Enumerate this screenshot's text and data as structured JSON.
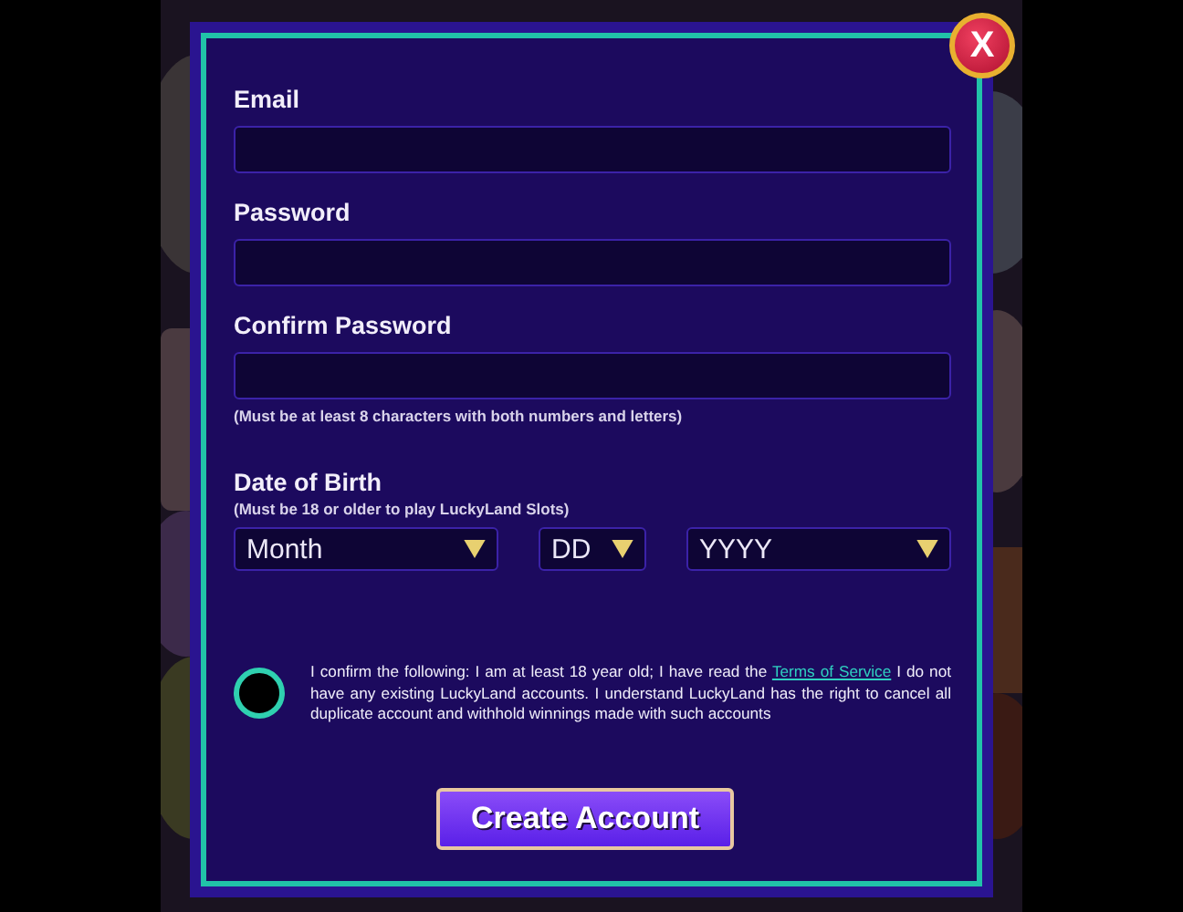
{
  "close_button": {
    "label": "X"
  },
  "fields": [
    {
      "kind": "input",
      "label": "Email"
    },
    {
      "kind": "input",
      "label": "Password"
    },
    {
      "kind": "input",
      "label": "Confirm Password",
      "hint": "(Must be at least 8 characters with both numbers and letters)"
    }
  ],
  "date_of_birth": {
    "label": "Date of Birth",
    "hint": "(Must be 18 or older to play LuckyLand Slots)",
    "selects": [
      {
        "kind": "wide",
        "placeholder": "Month"
      },
      {
        "kind": "narrow",
        "placeholder": "DD"
      },
      {
        "kind": "wide",
        "placeholder": "YYYY"
      }
    ]
  },
  "confirmation": {
    "checked": false,
    "text_before": "I confirm the following: I am at least 18 year old; I have read the ",
    "link": "Terms of Service",
    "text_after": " I do not have any existing LuckyLand accounts. I understand LuckyLand has the right to cancel all duplicate account and withhold winnings made with such accounts"
  },
  "submit_button": {
    "label": "Create Account"
  }
}
